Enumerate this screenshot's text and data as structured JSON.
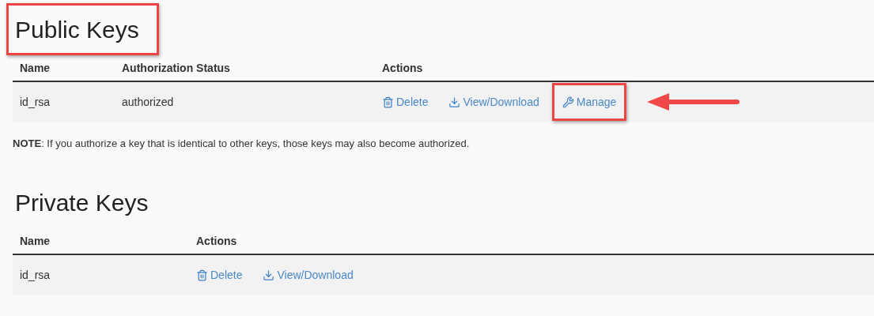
{
  "sections": [
    {
      "title": "Public Keys",
      "title_highlighted": true,
      "columns": [
        "Name",
        "Authorization Status",
        "Actions"
      ],
      "rows": [
        {
          "cells": [
            "id_rsa",
            "authorized"
          ],
          "actions": [
            {
              "kind": "delete",
              "label": "Delete",
              "highlighted": false,
              "pointed": false
            },
            {
              "kind": "download",
              "label": "View/Download",
              "highlighted": false,
              "pointed": false
            },
            {
              "kind": "manage",
              "label": "Manage",
              "highlighted": true,
              "pointed": true
            }
          ]
        }
      ],
      "note": "**NOTE**: If you authorize a key that is identical to other keys, those keys may also become authorized."
    },
    {
      "title": "Private Keys",
      "title_highlighted": false,
      "columns": [
        "Name",
        "Actions"
      ],
      "rows": [
        {
          "cells": [
            "id_rsa"
          ],
          "actions": [
            {
              "kind": "delete",
              "label": "Delete",
              "highlighted": false,
              "pointed": false
            },
            {
              "kind": "download",
              "label": "View/Download",
              "highlighted": false,
              "pointed": false
            }
          ]
        }
      ]
    }
  ]
}
